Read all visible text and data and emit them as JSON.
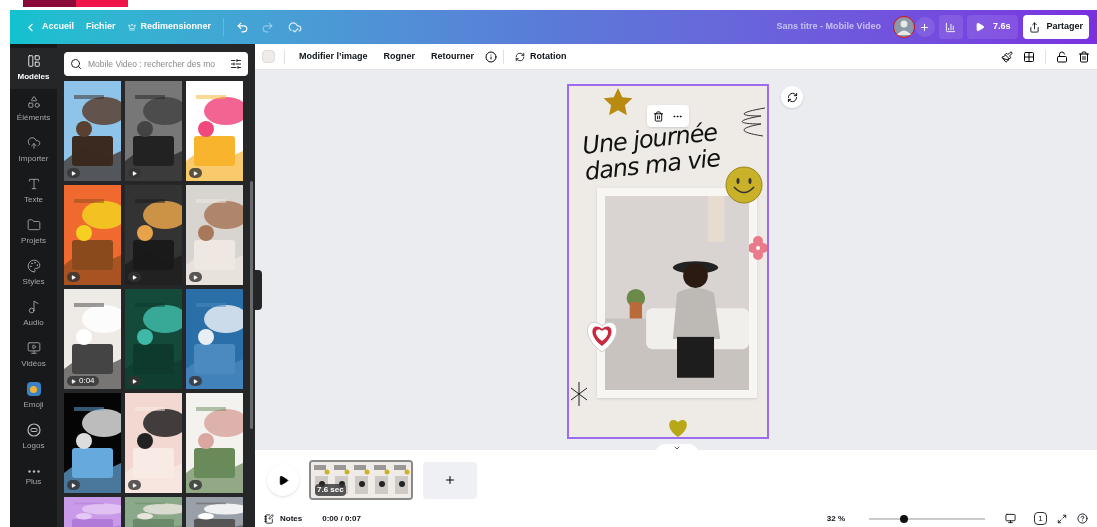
{
  "top_bar": {
    "menu": [
      {
        "label": "Accueil",
        "kind": "back"
      },
      {
        "label": "Fichier",
        "kind": "plain"
      },
      {
        "label": "Redimensionner",
        "kind": "crown"
      }
    ],
    "title": "Sans titre - Mobile Video",
    "play": "7.6s",
    "share": "Partager"
  },
  "toolbar": {
    "items": [
      {
        "label": "Modifier l’image",
        "kind": "plain"
      },
      {
        "label": "Rogner",
        "kind": "plain"
      },
      {
        "label": "Retourner",
        "kind": "plain"
      },
      {
        "label": "Rotation",
        "kind": "rotation"
      }
    ]
  },
  "rail": [
    {
      "label": "Modèles",
      "kind": "templates",
      "selected": true
    },
    {
      "label": "Éléments",
      "kind": "elements",
      "selected": false
    },
    {
      "label": "Importer",
      "kind": "upload",
      "selected": false
    },
    {
      "label": "Texte",
      "kind": "text",
      "selected": false
    },
    {
      "label": "Projets",
      "kind": "folder",
      "selected": false
    },
    {
      "label": "Styles",
      "kind": "palette",
      "selected": false
    },
    {
      "label": "Audio",
      "kind": "audio",
      "selected": false
    },
    {
      "label": "Vidéos",
      "kind": "video",
      "selected": false
    },
    {
      "label": "Emoji",
      "kind": "emoji",
      "selected": false
    },
    {
      "label": "Logos",
      "kind": "logo",
      "selected": false
    },
    {
      "label": "Plus",
      "kind": "more",
      "selected": false
    }
  ],
  "search": {
    "placeholder": "Mobile Video : rechercher des mo"
  },
  "templates": [
    {
      "kind": "picture"
    },
    {
      "kind": "picture"
    },
    {
      "kind": "picture"
    },
    {
      "kind": "picture"
    },
    {
      "kind": "picture"
    },
    {
      "kind": "picture"
    },
    {
      "kind": "picture",
      "duration": "0:04"
    },
    {
      "kind": "picture"
    },
    {
      "kind": "picture"
    },
    {
      "kind": "picture"
    },
    {
      "kind": "picture"
    },
    {
      "kind": "picture"
    }
  ],
  "templates_cut_off": [
    {
      "kind": "picture"
    },
    {
      "kind": "picture"
    },
    {
      "kind": "picture"
    }
  ],
  "design": {
    "heading": "Une journée dans ma vie"
  },
  "timeline": {
    "clip": "7.6 sec"
  },
  "footer": {
    "notes": "Notes",
    "time": "0:00 / 0:07",
    "zoom": "32 %",
    "zoom_slider": {
      "level": 0.3
    },
    "page": "1"
  }
}
